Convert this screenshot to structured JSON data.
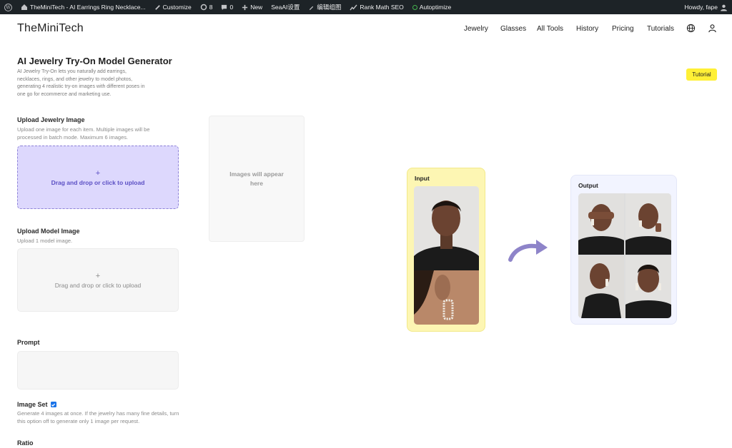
{
  "admin_bar": {
    "site_name": "TheMiniTech - AI Earrings Ring Necklace...",
    "customize": "Customize",
    "updates_count": "8",
    "comments_count": "0",
    "new": "New",
    "seaai": "SeaAI设置",
    "edit_group": "编辑组图",
    "rank_math": "Rank Math SEO",
    "autoptimize": "Autoptimize",
    "howdy": "Howdy, fape"
  },
  "header": {
    "brand": "TheMiniTech",
    "nav": [
      "Jewelry",
      "Glasses",
      "All Tools",
      "History",
      "Pricing",
      "Tutorials"
    ]
  },
  "page": {
    "title": "AI Jewelry Try-On Model Generator",
    "description": "AI Jewelry Try-On lets you naturally add earrings, necklaces, rings, and other jewelry to model photos, generating 4 realistic try-on images with different poses in one go for ecommerce and marketing use.",
    "tutorial_button": "Tutorial"
  },
  "upload_jewelry": {
    "label": "Upload Jewelry Image",
    "help": "Upload one image for each item. Multiple images will be processed in batch mode. Maximum 6 images.",
    "plus": "+",
    "drop_text": "Drag and drop or click to upload"
  },
  "upload_model": {
    "label": "Upload Model Image",
    "help": "Upload 1 model image.",
    "plus": "+",
    "drop_text": "Drag and drop or click to upload"
  },
  "prompt": {
    "label": "Prompt",
    "value": ""
  },
  "image_set": {
    "label": "Image Set",
    "checked": true,
    "help": "Generate 4 images at once. If the jewelry has many fine details, turn this option off to generate only 1 image per request."
  },
  "ratio": {
    "label": "Ratio"
  },
  "results": {
    "placeholder": "Images will appear here"
  },
  "demo": {
    "input_label": "Input",
    "output_label": "Output"
  },
  "colors": {
    "admin_bar_bg": "#1d2327",
    "accent_purple": "#ddd8fd",
    "tutorial_yellow": "#fff036",
    "input_card_bg": "#fdf6b3",
    "output_card_bg": "#f2f4ff"
  }
}
